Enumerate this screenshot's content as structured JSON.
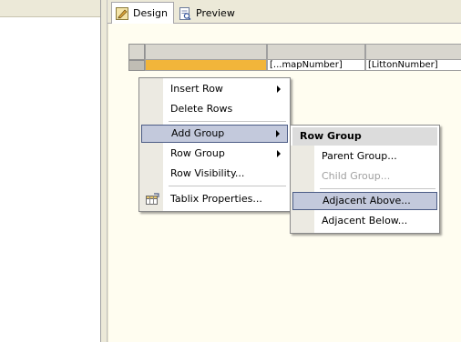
{
  "tabs": [
    {
      "label": "Design",
      "icon": "design-icon",
      "active": true
    },
    {
      "label": "Preview",
      "icon": "preview-icon",
      "active": false
    }
  ],
  "tablix": {
    "cells": [
      "[...mapNumber]",
      "[LittonNumber]"
    ]
  },
  "context_menu": {
    "items": [
      {
        "label": "Insert Row",
        "submenu": true
      },
      {
        "label": "Delete Rows",
        "submenu": false
      },
      {
        "label": "Add Group",
        "submenu": true,
        "highlighted": true
      },
      {
        "label": "Row Group",
        "submenu": true
      },
      {
        "label": "Row Visibility...",
        "submenu": false
      },
      {
        "label": "Tablix Properties...",
        "submenu": false,
        "icon": "properties-icon"
      }
    ]
  },
  "submenu": {
    "header": "Row Group",
    "items": [
      {
        "label": "Parent Group...",
        "enabled": true
      },
      {
        "label": "Child Group...",
        "enabled": false
      },
      {
        "label": "Adjacent Above...",
        "enabled": true,
        "highlighted": true
      },
      {
        "label": "Adjacent Below...",
        "enabled": true
      }
    ]
  },
  "colors": {
    "surface": "#fffdf0",
    "highlight": "#c3c9dc",
    "highlight_border": "#4c5c86",
    "chrome": "#ece9d8"
  }
}
